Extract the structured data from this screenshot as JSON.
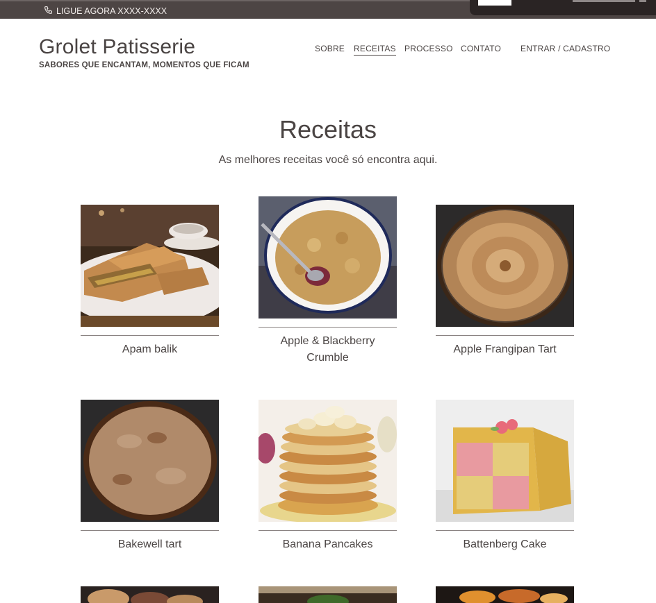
{
  "topbar": {
    "phone_text": "LIGUE AGORA XXXX-XXXX"
  },
  "brand": {
    "title": "Grolet Patisserie",
    "tagline": "SABORES QUE ENCANTAM, MOMENTOS QUE FICAM"
  },
  "nav": {
    "items": [
      {
        "label": "SOBRE",
        "active": false
      },
      {
        "label": "RECEITAS",
        "active": true
      },
      {
        "label": "PROCESSO",
        "active": false
      },
      {
        "label": "CONTATO",
        "active": false
      },
      {
        "label": "ENTRAR / CADASTRO",
        "active": false
      }
    ]
  },
  "page": {
    "title": "Receitas",
    "subtitle": "As melhores receitas você só encontra aqui."
  },
  "recipes": [
    {
      "name": "Apam balik"
    },
    {
      "name": "Apple & Blackberry Crumble"
    },
    {
      "name": "Apple Frangipan Tart"
    },
    {
      "name": "Bakewell tart"
    },
    {
      "name": "Banana Pancakes"
    },
    {
      "name": "Battenberg Cake"
    }
  ]
}
